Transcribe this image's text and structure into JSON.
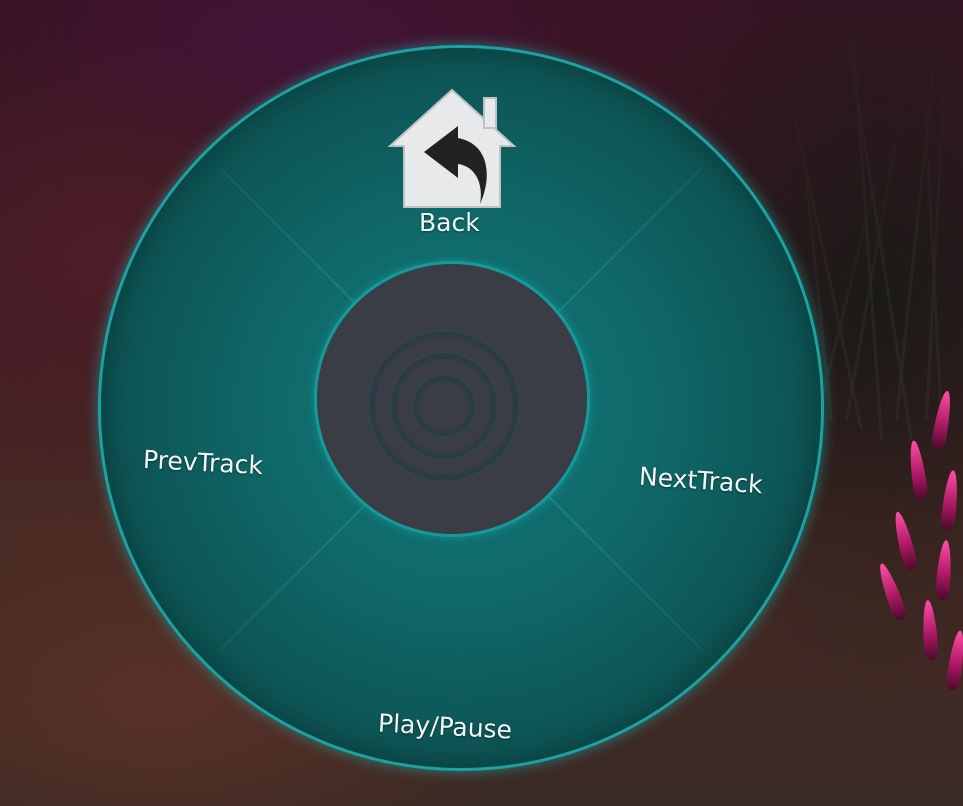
{
  "radial_menu": {
    "items": [
      {
        "id": "back",
        "label": "Back",
        "icon": "home-back-icon"
      },
      {
        "id": "next",
        "label": "NextTrack"
      },
      {
        "id": "play",
        "label": "Play/Pause"
      },
      {
        "id": "prev",
        "label": "PrevTrack"
      }
    ],
    "center_icon": "concentric-circles-icon"
  },
  "colors": {
    "wheel": "#106a6a",
    "wheel_edge": "#1aa3a3",
    "hub": "#3a3d46",
    "label": "#f4f6f6",
    "foliage_accent": "#d0207a"
  }
}
